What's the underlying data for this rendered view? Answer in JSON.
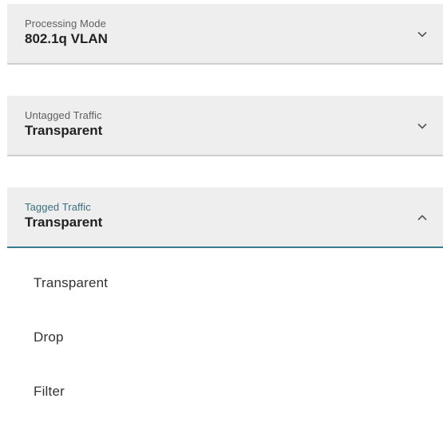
{
  "fields": [
    {
      "label": "Processing Mode",
      "value": "802.1q VLAN",
      "chevron": "chevron-down-icon"
    },
    {
      "label": "Untagged Traffic",
      "value": "Transparent",
      "chevron": "chevron-down-icon"
    },
    {
      "label": "Tagged Traffic",
      "value": "Transparent",
      "chevron": "chevron-up-icon"
    }
  ],
  "dropdown": {
    "options": [
      "Transparent",
      "Drop",
      "Filter"
    ]
  },
  "colors": {
    "field_background": "#eeeeee",
    "active_accent": "#3a7a8c",
    "text": "#222222"
  }
}
